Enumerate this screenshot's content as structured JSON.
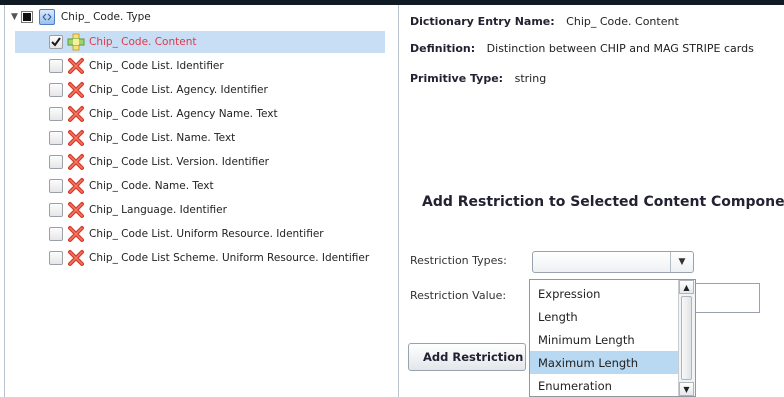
{
  "tree": {
    "root_label": "Chip_ Code. Type",
    "items": [
      {
        "label": "Chip_ Code. Content",
        "checked": true,
        "icon": "plus-icon",
        "selected": true
      },
      {
        "label": "Chip_ Code List. Identifier",
        "checked": false,
        "icon": "x-icon"
      },
      {
        "label": "Chip_ Code List. Agency. Identifier",
        "checked": false,
        "icon": "x-icon"
      },
      {
        "label": "Chip_ Code List. Agency Name. Text",
        "checked": false,
        "icon": "x-icon"
      },
      {
        "label": "Chip_ Code List. Name. Text",
        "checked": false,
        "icon": "x-icon"
      },
      {
        "label": "Chip_ Code List. Version. Identifier",
        "checked": false,
        "icon": "x-icon"
      },
      {
        "label": "Chip_ Code. Name. Text",
        "checked": false,
        "icon": "x-icon"
      },
      {
        "label": "Chip_ Language. Identifier",
        "checked": false,
        "icon": "x-icon"
      },
      {
        "label": "Chip_ Code List. Uniform Resource. Identifier",
        "checked": false,
        "icon": "x-icon"
      },
      {
        "label": "Chip_ Code List Scheme. Uniform Resource. Identifier",
        "checked": false,
        "icon": "x-icon"
      }
    ]
  },
  "details": {
    "den_label": "Dictionary Entry Name:",
    "den_value": "Chip_ Code. Content",
    "def_label": "Definition:",
    "def_value": "Distinction between CHIP and MAG STRIPE cards",
    "prim_label": "Primitive Type:",
    "prim_value": "string"
  },
  "restriction": {
    "heading": "Add Restriction to Selected Content Componen",
    "types_label": "Restriction Types:",
    "value_label": "Restriction Value:",
    "types_selected": "",
    "button_label": "Add Restriction",
    "options": [
      "Expression",
      "Length",
      "Minimum Length",
      "Maximum Length",
      "Enumeration"
    ],
    "highlighted_option": "Maximum Length"
  },
  "colors": {
    "selected_bg": "#c8def4",
    "selected_text": "#e0394a",
    "highlight_option": "#b9d8f1"
  }
}
